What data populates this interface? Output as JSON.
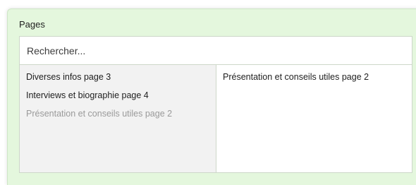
{
  "field": {
    "label": "Pages"
  },
  "search": {
    "placeholder": "Rechercher..."
  },
  "available": {
    "items": [
      {
        "label": "Diverses infos page 3",
        "state": "available"
      },
      {
        "label": "Interviews et biographie page 4",
        "state": "available"
      },
      {
        "label": "Présentation et conseils utiles page 2",
        "state": "already-selected"
      }
    ]
  },
  "selected": {
    "items": [
      {
        "label": "Présentation et conseils utiles page 2"
      }
    ]
  },
  "colors": {
    "panel_background": "#e4f7dd",
    "available_list_background": "#f2f2f2",
    "disabled_text": "#9a9a9a"
  }
}
